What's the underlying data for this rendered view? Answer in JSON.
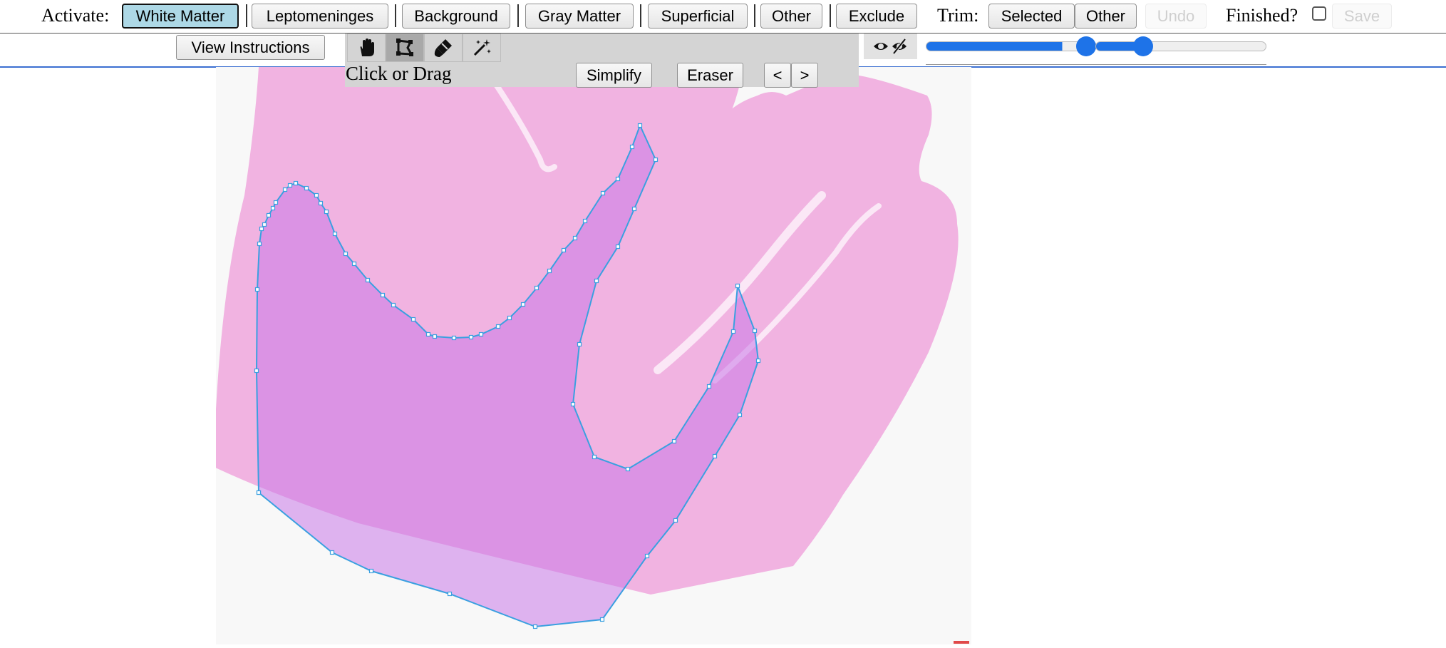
{
  "toolbar": {
    "activate_label": "Activate:",
    "classes": [
      "White Matter",
      "Leptomeninges",
      "Background",
      "Gray Matter",
      "Superficial",
      "Other",
      "Exclude"
    ],
    "active_class": "White Matter",
    "trim_label": "Trim:",
    "trim_selected": "Selected",
    "trim_other": "Other",
    "undo": "Undo",
    "finished_label": "Finished?",
    "finished_checked": false,
    "save": "Save"
  },
  "second_row": {
    "view_instructions": "View Instructions",
    "tools": [
      "hand-pan-icon",
      "polygon-draw-icon",
      "brush-icon",
      "magic-wand-icon"
    ],
    "active_tool": "polygon-draw-icon",
    "mode_label": "Click or Drag",
    "simplify": "Simplify",
    "eraser": "Eraser",
    "prev": "<",
    "next": ">",
    "visibility_icon": "eye-toggle-icon",
    "slider1_value": 0.8,
    "slider2_value": 0.27
  },
  "colors": {
    "active_button": "#add8e6",
    "annotation_stroke": "#3aa0e0",
    "annotation_fill": "#c878e8",
    "tissue_pink": "#f1b3e1",
    "slider_blue": "#1e73e8"
  }
}
